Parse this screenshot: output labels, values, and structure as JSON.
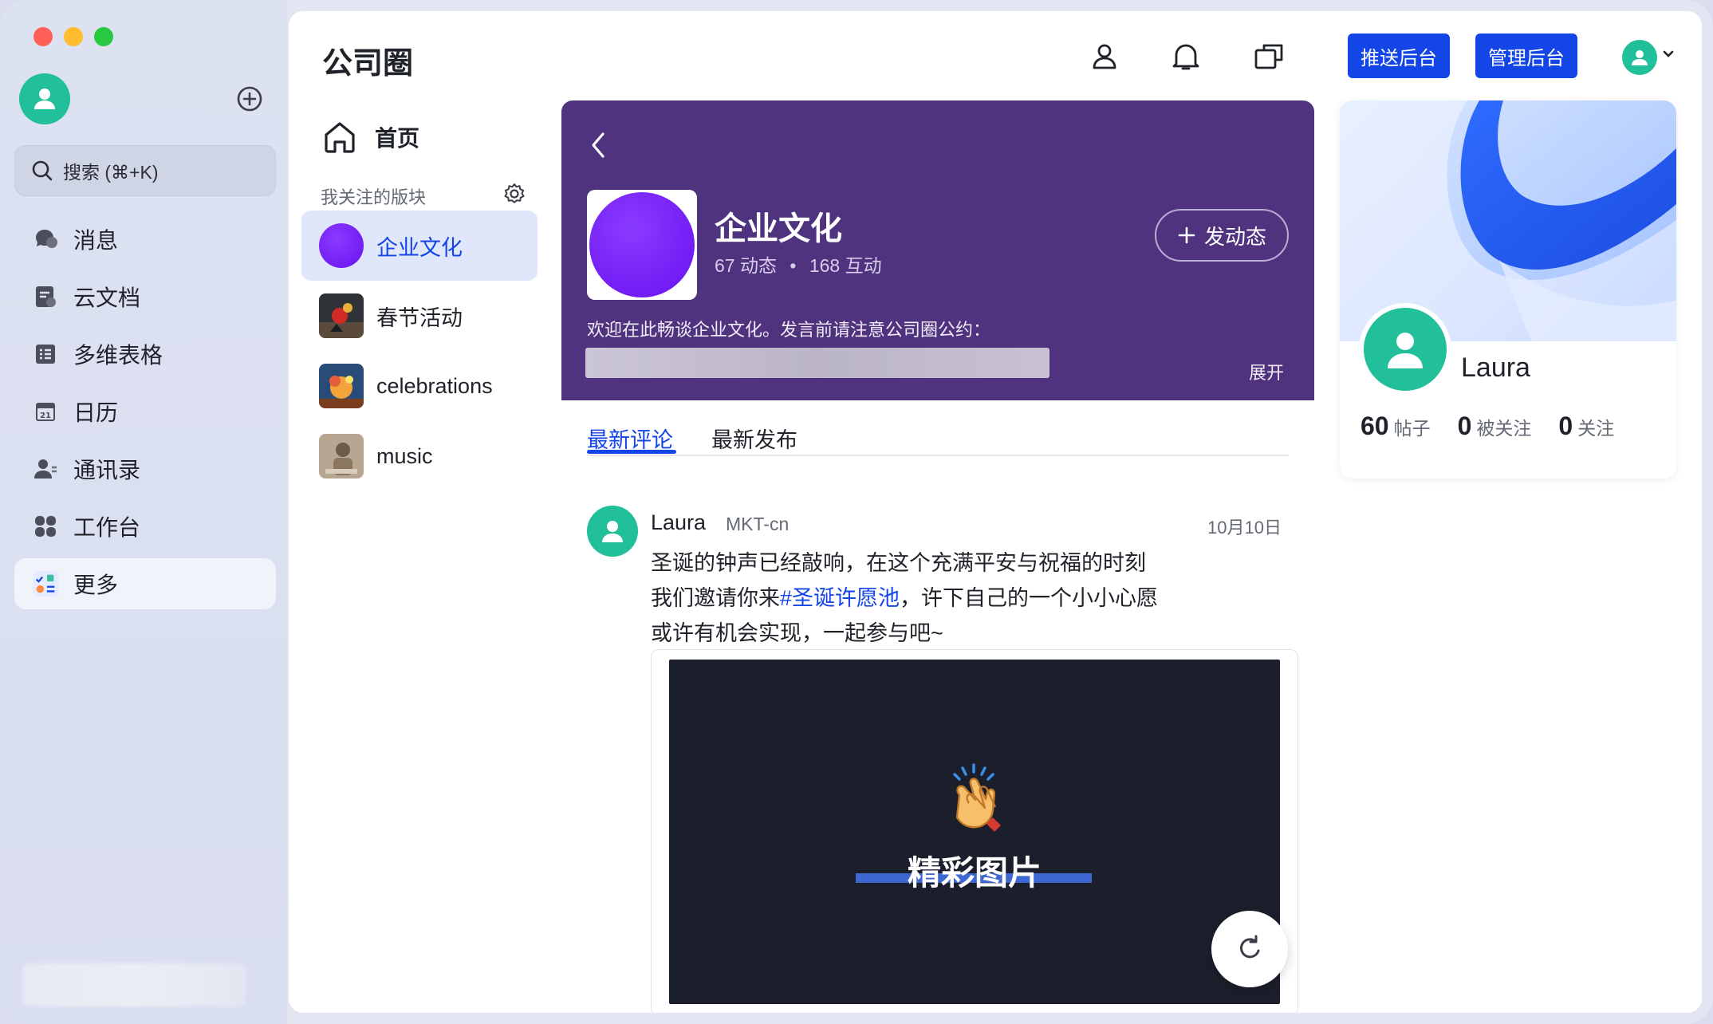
{
  "sidebar": {
    "search_placeholder": "搜索 (⌘+K)",
    "items": [
      {
        "label": "消息",
        "icon": "chat-icon"
      },
      {
        "label": "云文档",
        "icon": "document-icon"
      },
      {
        "label": "多维表格",
        "icon": "table-icon"
      },
      {
        "label": "日历",
        "icon": "calendar-icon"
      },
      {
        "label": "通讯录",
        "icon": "contacts-icon"
      },
      {
        "label": "工作台",
        "icon": "workspace-icon"
      },
      {
        "label": "更多",
        "icon": "more-apps-icon"
      }
    ],
    "calendar_day": "21"
  },
  "header": {
    "title": "公司圈",
    "push_admin_label": "推送后台",
    "manage_admin_label": "管理后台"
  },
  "boards": {
    "home_label": "首页",
    "section_label": "我关注的版块",
    "items": [
      {
        "label": "企业文化",
        "active": true
      },
      {
        "label": "春节活动",
        "active": false
      },
      {
        "label": "celebrations",
        "active": false
      },
      {
        "label": "music",
        "active": false
      }
    ]
  },
  "hero": {
    "title": "企业文化",
    "posts_count": "67 动态",
    "separator": "•",
    "interactions_count": "168 互动",
    "post_button_label": "发动态",
    "description": "欢迎在此畅谈企业文化。发言前请注意公司圈公约：",
    "expand_label": "展开",
    "background_color": "#50337e"
  },
  "tabs": [
    {
      "label": "最新评论",
      "active": true
    },
    {
      "label": "最新发布",
      "active": false
    }
  ],
  "post": {
    "author": "Laura",
    "department": "MKT-cn",
    "date": "10月10日",
    "line1": "圣诞的钟声已经敲响，在这个充满平安与祝福的时刻",
    "line2_prefix": "我们邀请你来",
    "hashtag": "#圣诞许愿池",
    "line2_suffix": "，许下自己的一个小小心愿",
    "line3": "或许有机会实现，一起参与吧~",
    "media_caption": "精彩图片"
  },
  "profile": {
    "name": "Laura",
    "posts_count": "60",
    "posts_label": "帖子",
    "followers_count": "0",
    "followers_label": "被关注",
    "following_count": "0",
    "following_label": "关注"
  },
  "colors": {
    "accent": "#1445e6",
    "avatar": "#21bf9a"
  }
}
